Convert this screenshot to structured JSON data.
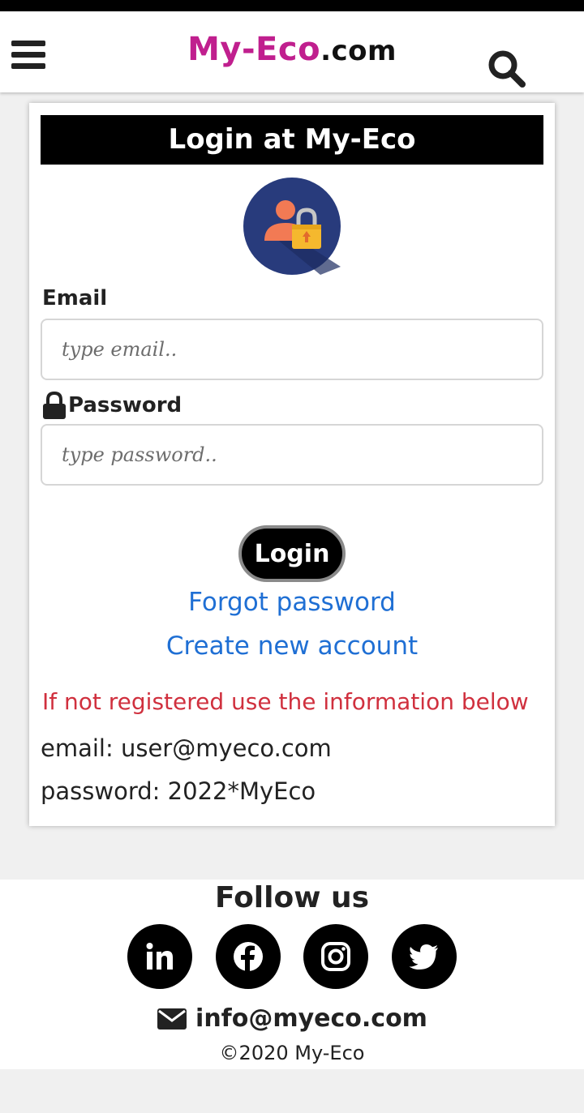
{
  "header": {
    "brand_main": "My-Eco",
    "brand_suffix": ".com",
    "brand_color": "#c01f8e"
  },
  "login": {
    "title": "Login at My-Eco",
    "email_label": "Email",
    "email_placeholder": "type email..",
    "password_label": "Password",
    "password_placeholder": "type password..",
    "submit_label": "Login",
    "forgot_label": "Forgot password",
    "create_label": "Create new account",
    "notice": "If not registered use the information below",
    "demo_email": "email: user@myeco.com",
    "demo_password": "password: 2022*MyEco"
  },
  "footer": {
    "follow_title": "Follow us",
    "social": [
      "linkedin-icon",
      "facebook-icon",
      "instagram-icon",
      "twitter-icon"
    ],
    "contact_email": "info@myeco.com",
    "copyright": "©2020 My-Eco"
  },
  "colors": {
    "link": "#1f6fd4",
    "notice": "#d0303e",
    "title_bar": "#000000"
  }
}
